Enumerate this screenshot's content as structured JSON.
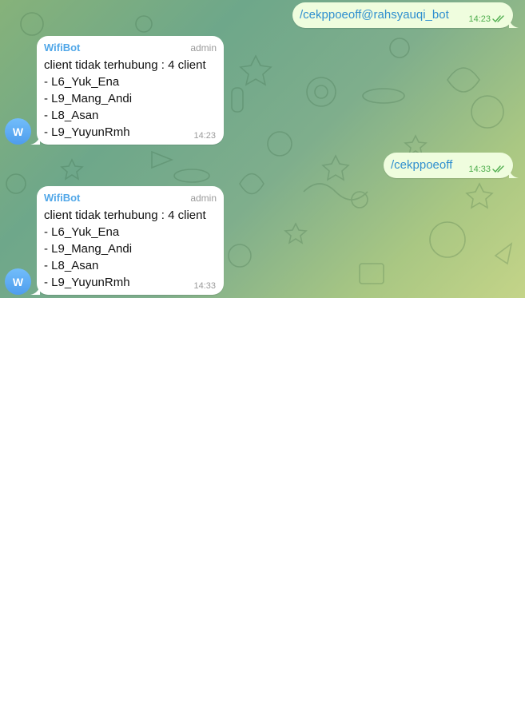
{
  "colors": {
    "outgoing_bubble": "#effdde",
    "incoming_bubble": "#ffffff",
    "command_link": "#2f8fcf",
    "sender_name": "#51a7e8",
    "read_check": "#4fae4e",
    "avatar": "#5aa8f2"
  },
  "messages": [
    {
      "direction": "outgoing",
      "text": "/cekppoeoff@rahsyauqi_bot",
      "time": "14:23",
      "status_icon": "double-check-icon"
    },
    {
      "direction": "incoming",
      "sender": "WifiBot",
      "role": "admin",
      "avatar_letter": "W",
      "lines": [
        "client tidak terhubung : 4 client",
        "- L6_Yuk_Ena",
        "- L9_Mang_Andi",
        "- L8_Asan",
        "- L9_YuyunRmh"
      ],
      "time": "14:23"
    },
    {
      "direction": "outgoing",
      "text": "/cekppoeoff",
      "time": "14:33",
      "status_icon": "double-check-icon"
    },
    {
      "direction": "incoming",
      "sender": "WifiBot",
      "role": "admin",
      "avatar_letter": "W",
      "lines": [
        "client tidak terhubung : 4 client",
        "- L6_Yuk_Ena",
        "- L9_Mang_Andi",
        "- L8_Asan",
        "- L9_YuyunRmh"
      ],
      "time": "14:33"
    }
  ]
}
